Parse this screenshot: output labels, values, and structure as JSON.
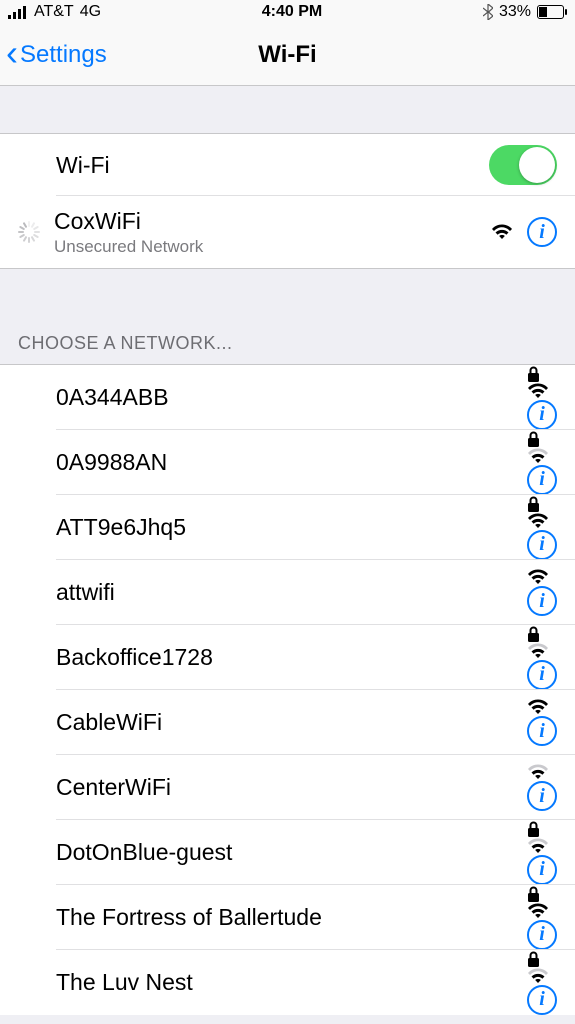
{
  "status": {
    "carrier": "AT&T",
    "network_type": "4G",
    "time": "4:40 PM",
    "battery_percent": "33%"
  },
  "nav": {
    "back_label": "Settings",
    "title": "Wi-Fi"
  },
  "wifi_toggle": {
    "label": "Wi-Fi",
    "on": true
  },
  "connecting": {
    "name": "CoxWiFi",
    "subtitle": "Unsecured Network",
    "signal": 3,
    "locked": false
  },
  "section_header": "Choose a Network...",
  "networks": [
    {
      "name": "0A344ABB",
      "locked": true,
      "signal": 3
    },
    {
      "name": "0A9988AN",
      "locked": true,
      "signal": 2
    },
    {
      "name": "ATT9e6Jhq5",
      "locked": true,
      "signal": 3
    },
    {
      "name": "attwifi",
      "locked": false,
      "signal": 3
    },
    {
      "name": "Backoffice1728",
      "locked": true,
      "signal": 2
    },
    {
      "name": "CableWiFi",
      "locked": false,
      "signal": 3
    },
    {
      "name": "CenterWiFi",
      "locked": false,
      "signal": 2
    },
    {
      "name": "DotOnBlue-guest",
      "locked": true,
      "signal": 2
    },
    {
      "name": "The Fortress of Ballertude",
      "locked": true,
      "signal": 3
    },
    {
      "name": "The Luv Nest",
      "locked": true,
      "signal": 2
    }
  ]
}
